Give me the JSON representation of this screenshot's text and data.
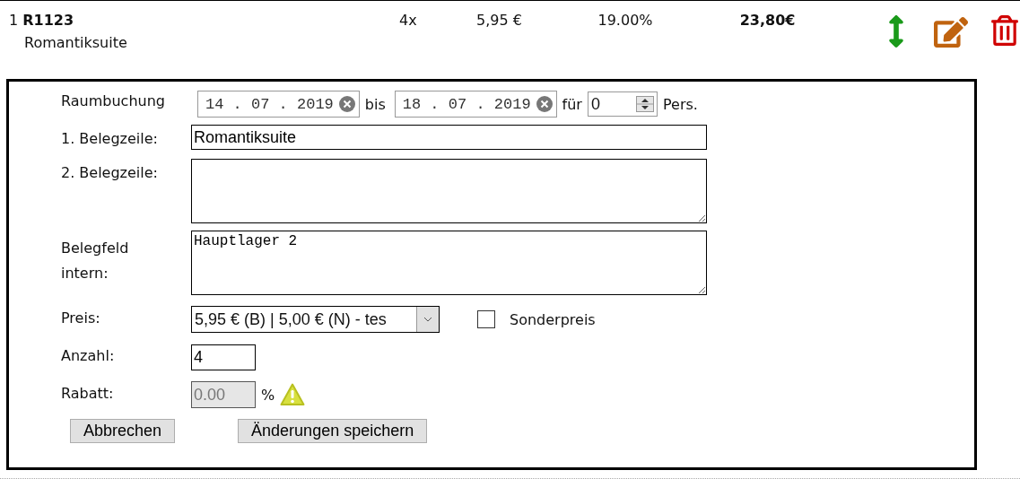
{
  "item": {
    "number": "1",
    "code": "R1123",
    "name": "Romantiksuite",
    "quantity": "4x",
    "price": "5,95 €",
    "tax": "19.00%",
    "total": "23,80€"
  },
  "form": {
    "booking": {
      "label": "Raumbuchung",
      "from": "14 . 07 . 2019",
      "between": "bis",
      "to": "18 . 07 . 2019",
      "for": "für",
      "persons": "0",
      "unit": "Pers."
    },
    "line1": {
      "label": "1. Belegzeile:",
      "value": "Romantiksuite"
    },
    "line2": {
      "label": "2. Belegzeile:"
    },
    "internal": {
      "label": "Belegfeld intern:",
      "value": "Hauptlager 2"
    },
    "price": {
      "label": "Preis:",
      "value": "5,95 € (B) | 5,00 € (N) - tes",
      "special_label": "Sonderpreis",
      "special_checked": false
    },
    "quantity": {
      "label": "Anzahl:",
      "value": "4"
    },
    "discount": {
      "label": "Rabatt:",
      "value": "0.00",
      "unit": "%",
      "disabled": true
    },
    "buttons": [
      "Abbrechen",
      "Änderungen speichern"
    ]
  }
}
